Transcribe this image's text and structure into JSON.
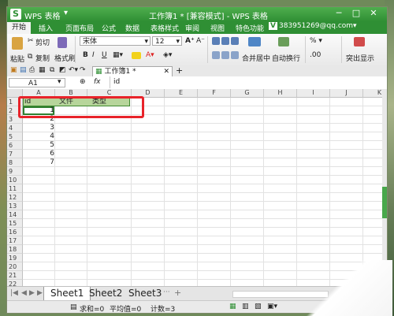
{
  "window": {
    "app_name": "WPS 表格",
    "app_logo": "S",
    "document_title": "工作簿1 * [兼容模式] - WPS 表格",
    "controls": [
      "─",
      "□",
      "✕"
    ]
  },
  "menu_tabs": [
    "开始",
    "插入",
    "页面布局",
    "公式",
    "数据",
    "表格样式",
    "审阅",
    "视图",
    "特色功能"
  ],
  "account": "383951269@qq.com",
  "ribbon": {
    "paste": "粘贴",
    "cut": "剪切",
    "copy": "复制",
    "format_painter": "格式刷",
    "font_name": "宋体",
    "font_size": "12",
    "bold": "B",
    "italic": "I",
    "underline": "U",
    "merge_center": "合并居中",
    "wrap_text": "自动换行",
    "number_format": "%",
    "highlight": "突出显示"
  },
  "quickbar": {
    "doc_tab": "工作簿1 *",
    "add_tab": "+"
  },
  "formula_bar": {
    "name_box": "A1",
    "fx": "fx",
    "content": "id"
  },
  "grid": {
    "columns": [
      "A",
      "B",
      "C",
      "D",
      "E",
      "F",
      "G",
      "H",
      "I",
      "J",
      "K"
    ],
    "rows": [
      "1",
      "2",
      "3",
      "4",
      "5",
      "6",
      "7",
      "8",
      "9",
      "10",
      "11",
      "12",
      "13",
      "14",
      "15",
      "16",
      "17",
      "18",
      "19",
      "20",
      "21",
      "22"
    ],
    "header_cells": [
      "id",
      "文件",
      "类型"
    ],
    "id_values": [
      "1",
      "2",
      "3",
      "4",
      "5",
      "6",
      "7"
    ]
  },
  "sheets": [
    "Sheet1",
    "Sheet2",
    "Sheet3"
  ],
  "sheet_more": "···",
  "sheet_add": "+",
  "status": {
    "sum": "求和=0",
    "avg": "平均值=0",
    "count": "计数=3"
  }
}
